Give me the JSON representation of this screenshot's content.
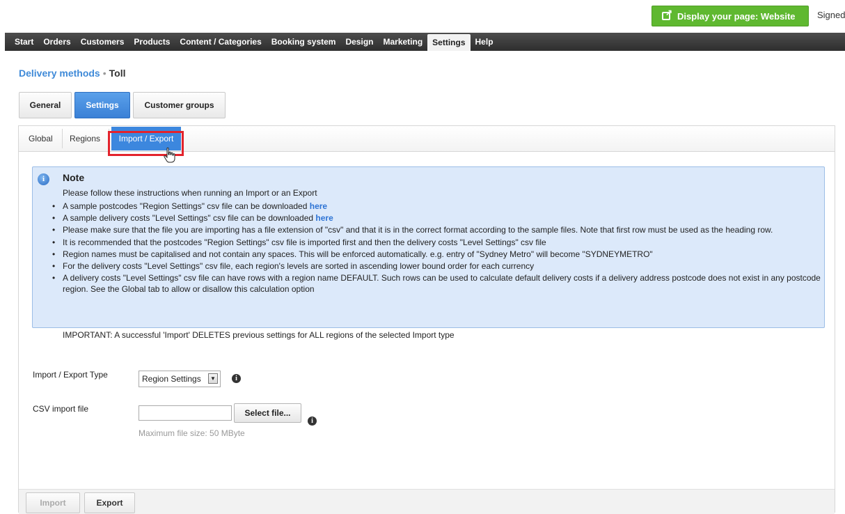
{
  "header": {
    "display_button_label": "Display your page: Website",
    "signed_text": "Signed"
  },
  "nav": {
    "items": [
      {
        "label": "Start"
      },
      {
        "label": "Orders"
      },
      {
        "label": "Customers"
      },
      {
        "label": "Products"
      },
      {
        "label": "Content / Categories"
      },
      {
        "label": "Booking system"
      },
      {
        "label": "Design"
      },
      {
        "label": "Marketing"
      },
      {
        "label": "Settings",
        "active": true
      },
      {
        "label": "Help"
      }
    ]
  },
  "breadcrumb": {
    "parent": "Delivery methods",
    "separator": "•",
    "current": "Toll"
  },
  "main_tabs": [
    {
      "label": "General"
    },
    {
      "label": "Settings",
      "active": true
    },
    {
      "label": "Customer groups"
    }
  ],
  "sub_tabs": [
    {
      "label": "Global"
    },
    {
      "label": "Regions"
    },
    {
      "label": "Import / Export",
      "active": true
    }
  ],
  "note": {
    "title": "Note",
    "intro": "Please follow these instructions when running an Import or an Export",
    "items": [
      {
        "text": "A sample postcodes \"Region Settings\" csv file can be downloaded ",
        "link": "here"
      },
      {
        "text": "A sample delivery costs \"Level Settings\" csv file can be downloaded ",
        "link": "here"
      },
      {
        "text": "Please make sure that the file you are importing has a file extension of \"csv\" and that it is in the correct format according to the sample files. Note that first row must be used as the heading row."
      },
      {
        "text": "It is recommended that the postcodes \"Region Settings\" csv file is imported first and then the delivery costs \"Level Settings\" csv file"
      },
      {
        "text": "Region names must be capitalised and not contain any spaces. This will be enforced automatically. e.g. entry of \"Sydney Metro\" will become \"SYDNEYMETRO\""
      },
      {
        "text": "For the delivery costs \"Level Settings\" csv file, each region's levels are sorted in ascending lower bound order for each currency"
      },
      {
        "text": "A delivery costs \"Level Settings\" csv file can have rows with a region name DEFAULT. Such rows can be used to calculate default delivery costs if a delivery address postcode does not exist in any postcode region. See the Global tab to allow or disallow this calculation option"
      }
    ],
    "important": "IMPORTANT: A successful 'Import' DELETES previous settings for ALL regions of the selected Import type"
  },
  "form": {
    "type_label": "Import / Export Type",
    "type_value": "Region Settings",
    "csv_label": "CSV import file",
    "select_file_label": "Select file...",
    "max_size": "Maximum file size: 50 MByte"
  },
  "footer": {
    "import_label": "Import",
    "export_label": "Export"
  },
  "colors": {
    "accent_blue": "#3c87de",
    "highlight_red": "#e3232c",
    "display_green": "#5fb830",
    "note_bg": "#dce9fa"
  }
}
